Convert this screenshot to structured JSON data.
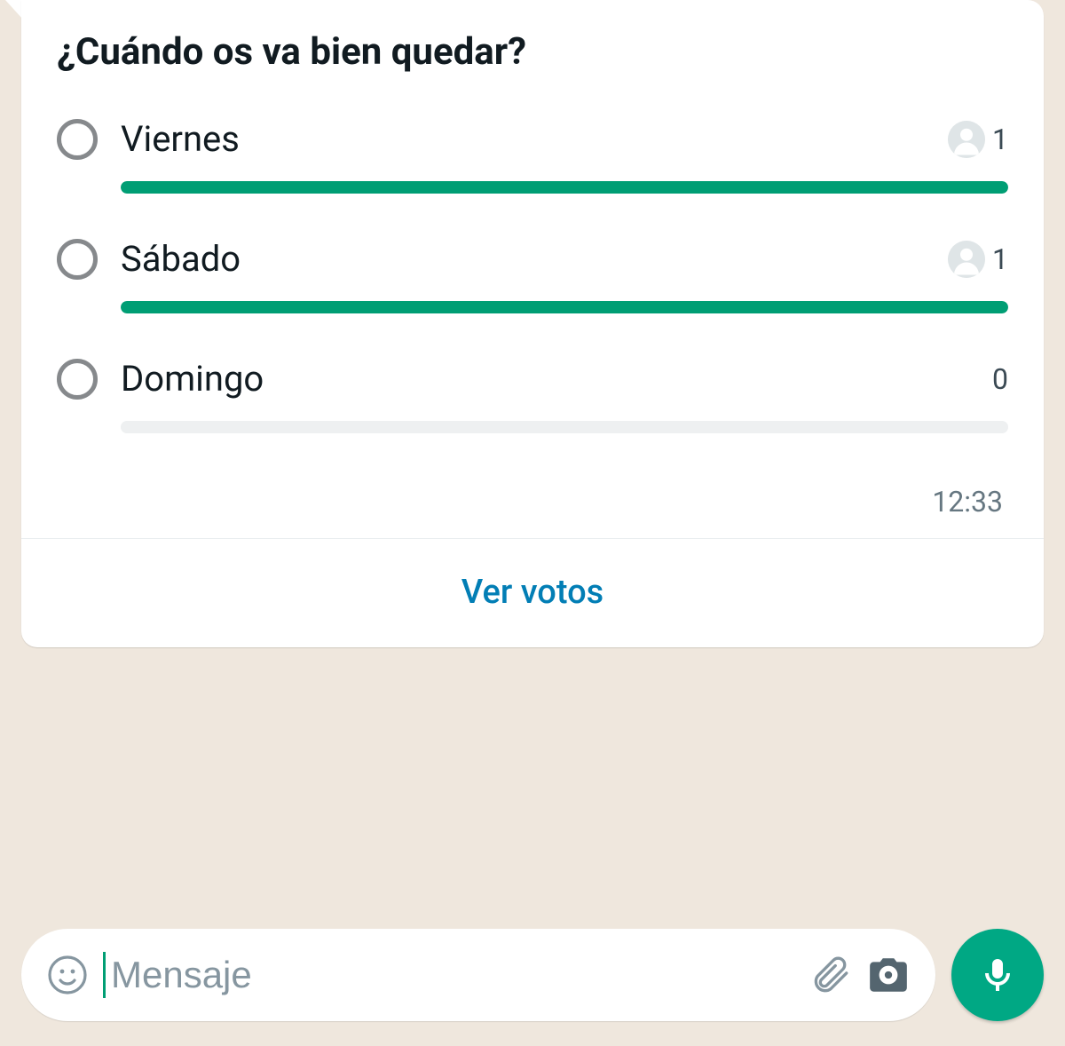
{
  "poll": {
    "question": "¿Cuándo os va bien quedar?",
    "options": [
      {
        "label": "Viernes",
        "votes": 1,
        "showAvatar": true,
        "barPercent": 100
      },
      {
        "label": "Sábado",
        "votes": 1,
        "showAvatar": true,
        "barPercent": 100
      },
      {
        "label": "Domingo",
        "votes": 0,
        "showAvatar": false,
        "barPercent": 0
      }
    ],
    "timestamp": "12:33",
    "view_votes_label": "Ver votos"
  },
  "composer": {
    "placeholder": "Mensaje"
  },
  "colors": {
    "accent": "#009e74",
    "link": "#027eb5",
    "mic": "#00a884"
  }
}
